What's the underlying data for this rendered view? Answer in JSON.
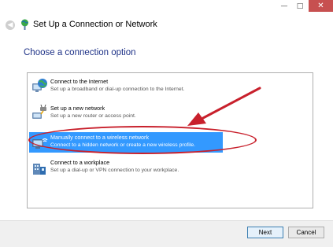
{
  "window": {
    "title": "Set Up a Connection or Network",
    "controls": {
      "minimize": "—",
      "maximize": "□",
      "close": "✕"
    }
  },
  "heading": "Choose a connection option",
  "options": [
    {
      "title": "Connect to the Internet",
      "description": "Set up a broadband or dial-up connection to the Internet.",
      "icon": "globe-network-icon",
      "selected": false
    },
    {
      "title": "Set up a new network",
      "description": "Set up a new router or access point.",
      "icon": "router-network-icon",
      "selected": false
    },
    {
      "title": "Manually connect to a wireless network",
      "description": "Connect to a hidden network or create a new wireless profile.",
      "icon": "wireless-computer-icon",
      "selected": true
    },
    {
      "title": "Connect to a workplace",
      "description": "Set up a dial-up or VPN connection to your workplace.",
      "icon": "workplace-building-icon",
      "selected": false
    }
  ],
  "buttons": {
    "next": "Next",
    "cancel": "Cancel"
  },
  "colors": {
    "heading": "#1e3287",
    "selection": "#3399ff",
    "annotation": "#c8202c",
    "close_button": "#c75050"
  }
}
